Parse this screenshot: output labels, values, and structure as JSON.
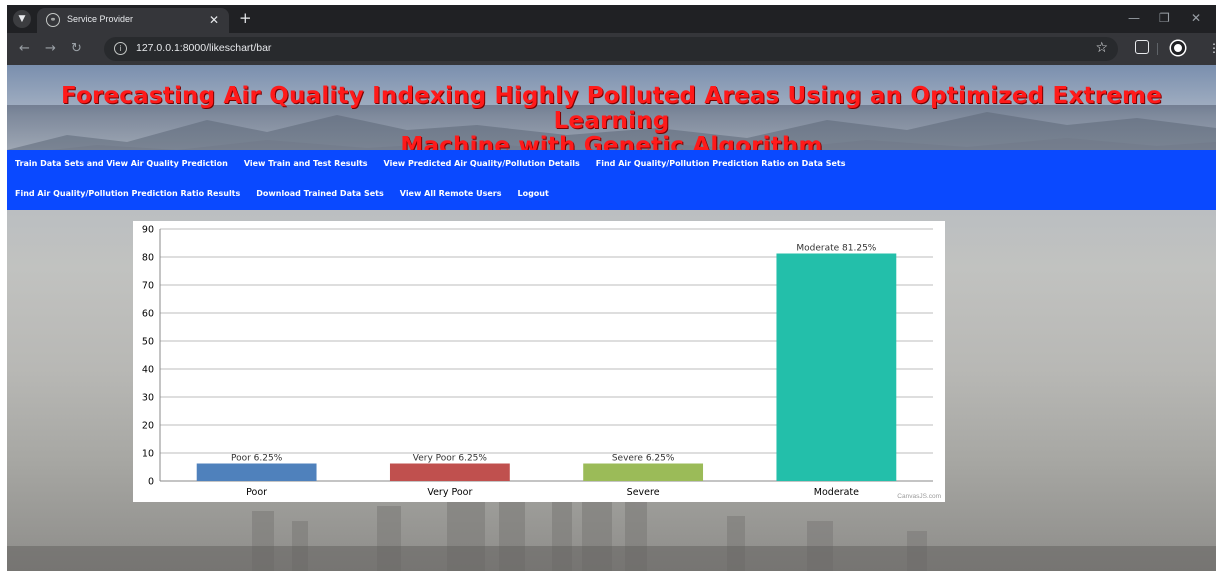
{
  "browser": {
    "tab_title": "Service Provider",
    "url": "127.0.0.1:8000/likeschart/bar"
  },
  "page": {
    "title_line1": "Forecasting Air Quality Indexing Highly Polluted Areas Using an Optimized Extreme Learning",
    "title_line2": "Machine with Genetic Algorithm",
    "nav_row1": [
      "Train Data Sets and View Air Quality Prediction",
      "View Train and Test Results",
      "View Predicted Air Quality/Pollution Details",
      "Find Air Quality/Pollution Prediction Ratio on Data Sets"
    ],
    "nav_row2": [
      "Find Air Quality/Pollution Prediction Ratio Results",
      "Download Trained Data Sets",
      "View All Remote Users",
      "Logout"
    ],
    "colors": {
      "title": "#ff1a1a",
      "navbar": "#0a49ff"
    }
  },
  "chart_data": {
    "type": "bar",
    "categories": [
      "Poor",
      "Very Poor",
      "Severe",
      "Moderate"
    ],
    "values": [
      6.25,
      6.25,
      6.25,
      81.25
    ],
    "data_labels": [
      "Poor 6.25%",
      "Very Poor 6.25%",
      "Severe 6.25%",
      "Moderate 81.25%"
    ],
    "colors": [
      "#4f81bc",
      "#c0504e",
      "#9bbb58",
      "#23bfaa"
    ],
    "ylim": [
      0,
      90
    ],
    "yticks": [
      0,
      10,
      20,
      30,
      40,
      50,
      60,
      70,
      80,
      90
    ],
    "grid": true,
    "credit": "CanvasJS.com"
  }
}
